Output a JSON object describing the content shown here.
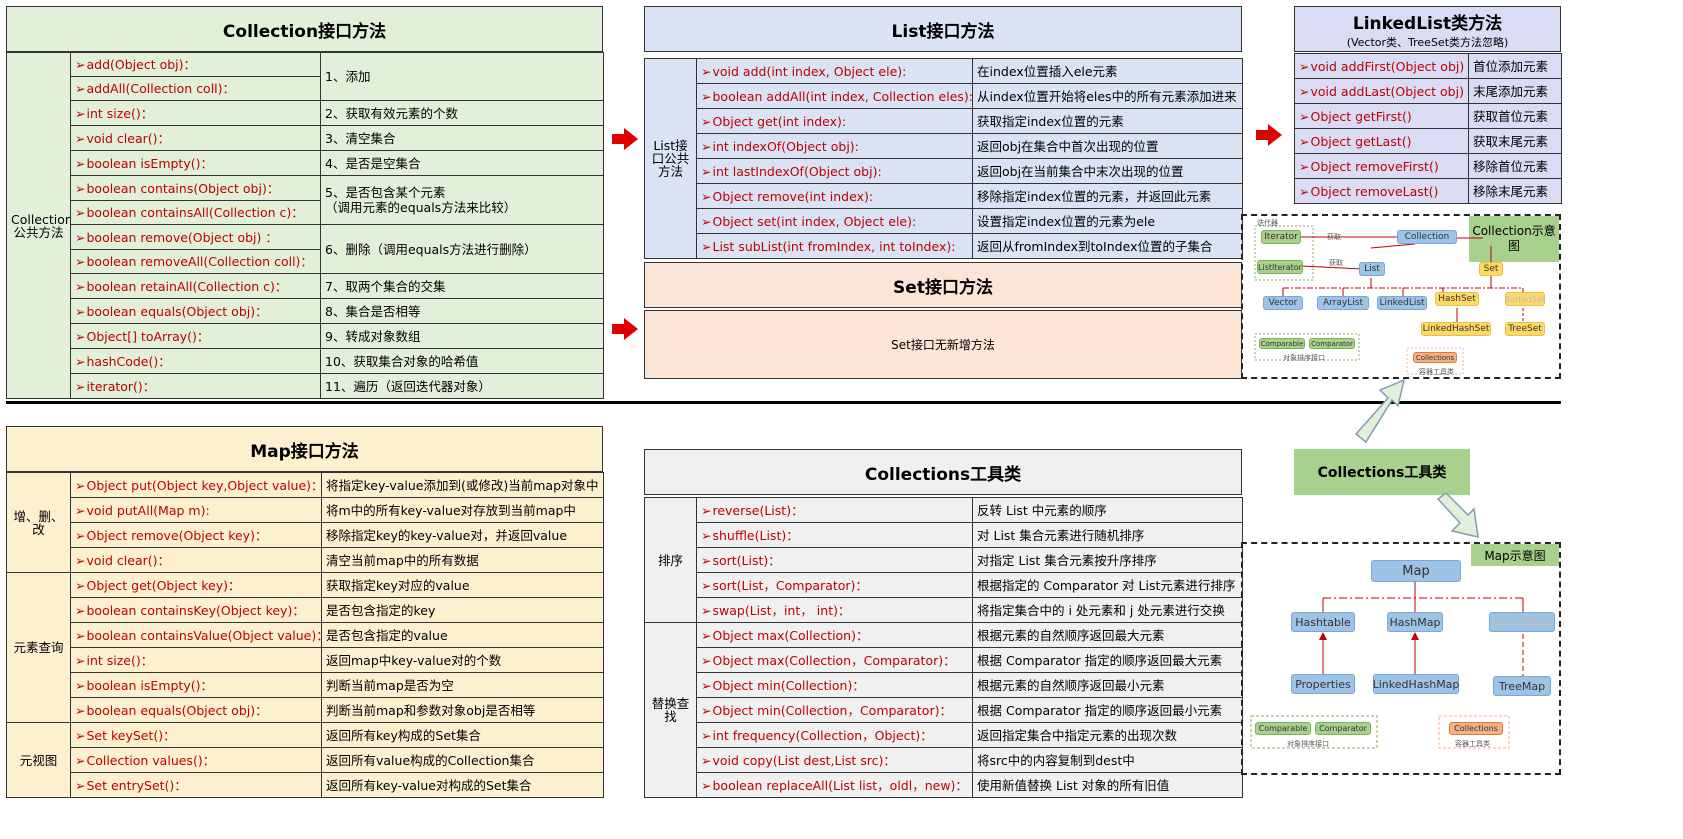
{
  "collection": {
    "title": "Collection接口方法",
    "category": "Collection公共方法",
    "rows": [
      {
        "m": "add(Object obj)：",
        "d": "1、添加"
      },
      {
        "m": "addAll(Collection coll)："
      },
      {
        "m": "int size()：",
        "d": "2、获取有效元素的个数"
      },
      {
        "m": "void clear()：",
        "d": "3、清空集合"
      },
      {
        "m": "boolean isEmpty()：",
        "d": "4、是否是空集合"
      },
      {
        "m": "boolean contains(Object obj)：",
        "d": "5、是否包含某个元素\n（调用元素的equals方法来比较）"
      },
      {
        "m": "boolean containsAll(Collection c)："
      },
      {
        "m": "boolean remove(Object obj) ：",
        "d": "6、删除（调用equals方法进行删除）"
      },
      {
        "m": "boolean removeAll(Collection coll)："
      },
      {
        "m": "boolean retainAll(Collection c)：",
        "d": "7、取两个集合的交集"
      },
      {
        "m": "boolean equals(Object obj)：",
        "d": "8、集合是否相等"
      },
      {
        "m": "Object[] toArray()：",
        "d": "9、转成对象数组"
      },
      {
        "m": "hashCode()：",
        "d": "10、获取集合对象的哈希值"
      },
      {
        "m": "iterator()：",
        "d": "11、遍历（返回迭代器对象）"
      }
    ]
  },
  "list": {
    "title": "List接口方法",
    "category": "List接口公共方法",
    "rows": [
      {
        "m": "void add(int index, Object ele):",
        "d": "在index位置插入ele元素"
      },
      {
        "m": "boolean addAll(int index, Collection eles):",
        "d": "从index位置开始将eles中的所有元素添加进来"
      },
      {
        "m": "Object get(int index):",
        "d": "获取指定index位置的元素"
      },
      {
        "m": "int indexOf(Object obj):",
        "d": "返回obj在集合中首次出现的位置"
      },
      {
        "m": "int lastIndexOf(Object obj):",
        "d": "返回obj在当前集合中末次出现的位置"
      },
      {
        "m": "Object remove(int index):",
        "d": "移除指定index位置的元素，并返回此元素"
      },
      {
        "m": "Object set(int index, Object ele):",
        "d": "设置指定index位置的元素为ele"
      },
      {
        "m": "List subList(int fromIndex, int toIndex):",
        "d": "返回从fromIndex到toIndex位置的子集合"
      }
    ]
  },
  "linkedlist": {
    "title": "LinkedList类方法",
    "subtitle": "(Vector类、TreeSet类方法忽略)",
    "rows": [
      {
        "m": "void addFirst(Object obj)",
        "d": "首位添加元素"
      },
      {
        "m": "void addLast(Object obj)",
        "d": "末尾添加元素"
      },
      {
        "m": "Object getFirst()",
        "d": "获取首位元素"
      },
      {
        "m": "Object getLast()",
        "d": "获取末尾元素"
      },
      {
        "m": "Object removeFirst()",
        "d": "移除首位元素"
      },
      {
        "m": "Object removeLast()",
        "d": "移除末尾元素"
      }
    ]
  },
  "set": {
    "title": "Set接口方法",
    "body": "Set接口无新增方法"
  },
  "collection_diagram": {
    "label": "Collection示意图",
    "nodes": {
      "iterator": "Iterator",
      "collection": "Collection",
      "listiterator": "ListIterator",
      "list": "List",
      "set": "Set",
      "vector": "Vector",
      "arraylist": "ArrayList",
      "linkedlist": "LinkedList",
      "hashset": "HashSet",
      "sortedset": "SortedSet",
      "linkedhashset": "LinkedHashSet",
      "treeset": "TreeSet",
      "comparable": "Comparable",
      "comparator": "Comparator",
      "collections": "Collections"
    },
    "captions": {
      "iter_group": "迭代器",
      "get1": "获取",
      "get2": "获取",
      "sort_group": "对象排序接口",
      "util_group": "容器工具类"
    }
  },
  "collections_tool_label": "Collections工具类",
  "map": {
    "title": "Map接口方法",
    "groups": [
      {
        "cat": "增、删、改",
        "rows": [
          {
            "m": "Object put(Object key,Object value)：",
            "d": "将指定key-value添加到(或修改)当前map对象中"
          },
          {
            "m": "void putAll(Map m):",
            "d": "将m中的所有key-value对存放到当前map中"
          },
          {
            "m": "Object remove(Object key)：",
            "d": "移除指定key的key-value对，并返回value"
          },
          {
            "m": "void clear()：",
            "d": "清空当前map中的所有数据"
          }
        ]
      },
      {
        "cat": "元素查询",
        "rows": [
          {
            "m": "Object get(Object key)：",
            "d": "获取指定key对应的value"
          },
          {
            "m": "boolean containsKey(Object key)：",
            "d": "是否包含指定的key"
          },
          {
            "m": "boolean containsValue(Object value)：",
            "d": "是否包含指定的value"
          },
          {
            "m": "int size()：",
            "d": "返回map中key-value对的个数"
          },
          {
            "m": "boolean isEmpty()：",
            "d": "判断当前map是否为空"
          },
          {
            "m": "boolean equals(Object obj)：",
            "d": "判断当前map和参数对象obj是否相等"
          }
        ]
      },
      {
        "cat": "元视图",
        "rows": [
          {
            "m": "Set keySet()：",
            "d": "返回所有key构成的Set集合"
          },
          {
            "m": "Collection values()：",
            "d": "返回所有value构成的Collection集合"
          },
          {
            "m": "Set entrySet()：",
            "d": "返回所有key-value对构成的Set集合"
          }
        ]
      }
    ]
  },
  "collections_util": {
    "title": "Collections工具类",
    "groups": [
      {
        "cat": "排序",
        "rows": [
          {
            "m": "reverse(List)：",
            "d": "反转 List 中元素的顺序"
          },
          {
            "m": "shuffle(List)：",
            "d": "对 List 集合元素进行随机排序"
          },
          {
            "m": "sort(List)：",
            "d": "对指定 List 集合元素按升序排序"
          },
          {
            "m": "sort(List，Comparator)：",
            "d": "根据指定的 Comparator 对 List元素进行排序"
          },
          {
            "m": "swap(List，int，  int)：",
            "d": "将指定集合中的 i 处元素和 j 处元素进行交换"
          }
        ]
      },
      {
        "cat": "替换查找",
        "rows": [
          {
            "m": "Object max(Collection)：",
            "d": "根据元素的自然顺序返回最大元素"
          },
          {
            "m": "Object max(Collection，Comparator)：",
            "d": "根据 Comparator 指定的顺序返回最大元素"
          },
          {
            "m": "Object min(Collection)：",
            "d": "根据元素的自然顺序返回最小元素"
          },
          {
            "m": "Object min(Collection，Comparator)：",
            "d": "根据 Comparator 指定的顺序返回最小元素"
          },
          {
            "m": "int frequency(Collection，Object)：",
            "d": "返回指定集合中指定元素的出现次数"
          },
          {
            "m": "void copy(List dest,List src)：",
            "d": "将src中的内容复制到dest中"
          },
          {
            "m": "boolean replaceAll(List list，oldl，new)：",
            "d": "使用新值替换 List 对象的所有旧值"
          }
        ]
      }
    ]
  },
  "map_diagram": {
    "label": "Map示意图",
    "nodes": {
      "map": "Map",
      "hashtable": "Hashtable",
      "hashmap": "HashMap",
      "sortedmap": "SortedMap",
      "properties": "Properties",
      "linkedhashmap": "LinkedHashMap",
      "treemap": "TreeMap",
      "comparable": "Comparable",
      "comparator": "Comparator",
      "collections": "Collections"
    },
    "captions": {
      "sort_group": "对象排序接口",
      "util_group": "容器工具类"
    }
  }
}
